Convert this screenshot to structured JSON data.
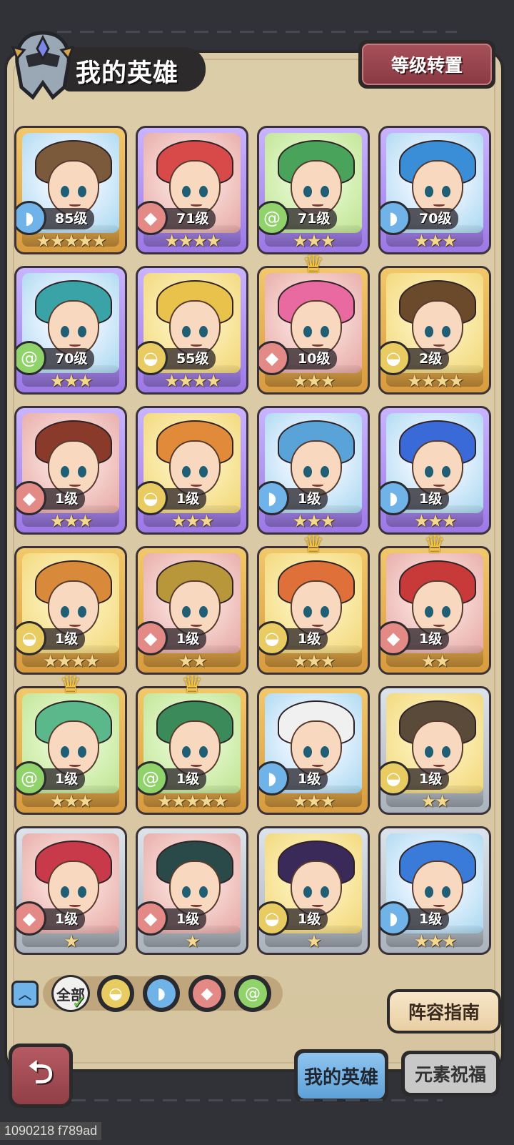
{
  "header": {
    "title": "我的英雄",
    "reset_label": "等级转置"
  },
  "colors": {
    "water": "#6fb3e9",
    "fire": "#e48a86",
    "wind": "#8fd36a",
    "earth": "#e8cc62",
    "panel": "#d9c9a6",
    "accent_red": "#a6505a",
    "tab_active": "#5ea1d8"
  },
  "heroes": [
    {
      "level": "85级",
      "stars": "★★★★★",
      "element": "water",
      "rarity": "gold",
      "bg": "blue",
      "crown": false
    },
    {
      "level": "71级",
      "stars": "★★★★",
      "element": "fire",
      "rarity": "purple",
      "bg": "pink",
      "crown": false
    },
    {
      "level": "71级",
      "stars": "★★★",
      "element": "wind",
      "rarity": "purple",
      "bg": "green",
      "crown": false
    },
    {
      "level": "70级",
      "stars": "★★★",
      "element": "water",
      "rarity": "purple",
      "bg": "blue",
      "crown": false
    },
    {
      "level": "70级",
      "stars": "★★★",
      "element": "wind",
      "rarity": "purple",
      "bg": "blue",
      "crown": false
    },
    {
      "level": "55级",
      "stars": "★★★★",
      "element": "earth",
      "rarity": "purple",
      "bg": "yellow",
      "crown": false
    },
    {
      "level": "10级",
      "stars": "★★★",
      "element": "fire",
      "rarity": "gold",
      "bg": "pink",
      "crown": true
    },
    {
      "level": "2级",
      "stars": "★★★★",
      "element": "earth",
      "rarity": "gold",
      "bg": "yellow",
      "crown": false
    },
    {
      "level": "1级",
      "stars": "★★★",
      "element": "fire",
      "rarity": "purple",
      "bg": "pink",
      "crown": false
    },
    {
      "level": "1级",
      "stars": "★★★",
      "element": "earth",
      "rarity": "purple",
      "bg": "yellow",
      "crown": false
    },
    {
      "level": "1级",
      "stars": "★★★",
      "element": "water",
      "rarity": "purple",
      "bg": "blue",
      "crown": false
    },
    {
      "level": "1级",
      "stars": "★★★",
      "element": "water",
      "rarity": "purple",
      "bg": "blue",
      "crown": false
    },
    {
      "level": "1级",
      "stars": "★★★★",
      "element": "earth",
      "rarity": "gold",
      "bg": "yellow",
      "crown": false
    },
    {
      "level": "1级",
      "stars": "★★",
      "element": "fire",
      "rarity": "gold",
      "bg": "pink",
      "crown": false
    },
    {
      "level": "1级",
      "stars": "★★★",
      "element": "earth",
      "rarity": "gold",
      "bg": "yellow",
      "crown": true
    },
    {
      "level": "1级",
      "stars": "★★",
      "element": "fire",
      "rarity": "gold",
      "bg": "pink",
      "crown": true
    },
    {
      "level": "1级",
      "stars": "★★★",
      "element": "wind",
      "rarity": "gold",
      "bg": "green",
      "crown": true
    },
    {
      "level": "1级",
      "stars": "★★★★★",
      "element": "wind",
      "rarity": "gold",
      "bg": "green",
      "crown": true
    },
    {
      "level": "1级",
      "stars": "★★★",
      "element": "water",
      "rarity": "gold",
      "bg": "blue",
      "crown": false
    },
    {
      "level": "1级",
      "stars": "★★",
      "element": "earth",
      "rarity": "silver",
      "bg": "yellow",
      "crown": false
    },
    {
      "level": "1级",
      "stars": "★",
      "element": "fire",
      "rarity": "silver",
      "bg": "pink",
      "crown": false
    },
    {
      "level": "1级",
      "stars": "★",
      "element": "fire",
      "rarity": "silver",
      "bg": "pink",
      "crown": false
    },
    {
      "level": "1级",
      "stars": "★",
      "element": "earth",
      "rarity": "silver",
      "bg": "yellow",
      "crown": false
    },
    {
      "level": "1级",
      "stars": "★★★",
      "element": "water",
      "rarity": "silver",
      "bg": "blue",
      "crown": false
    }
  ],
  "filter": {
    "all_label": "全部",
    "collapse_icon": "chevron-up-icon",
    "elements": [
      "earth",
      "water",
      "fire",
      "wind"
    ]
  },
  "guide_label": "阵容指南",
  "tabs": {
    "my_heroes": "我的英雄",
    "blessing": "元素祝福"
  },
  "footer_id": "1090218 f789ad"
}
